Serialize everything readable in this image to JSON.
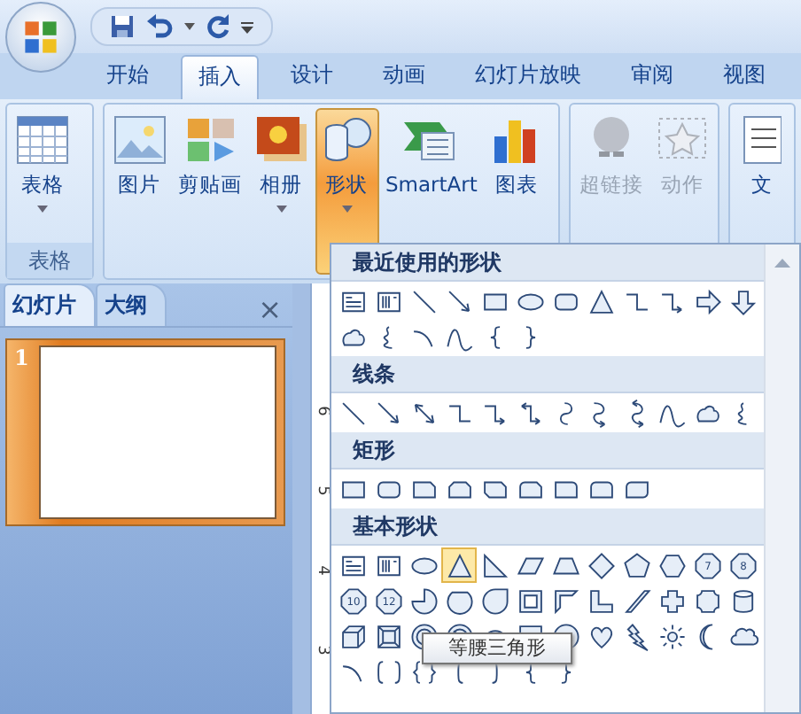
{
  "tabs": [
    {
      "label": "开始",
      "selected": false
    },
    {
      "label": "插入",
      "selected": true
    },
    {
      "label": "设计",
      "selected": false
    },
    {
      "label": "动画",
      "selected": false
    },
    {
      "label": "幻灯片放映",
      "selected": false
    },
    {
      "label": "审阅",
      "selected": false
    },
    {
      "label": "视图",
      "selected": false
    }
  ],
  "ribbon": {
    "groups": [
      {
        "label": "表格",
        "buttons": [
          {
            "kind": "table",
            "label": "表格",
            "has_menu": true,
            "disabled": false,
            "pressed": false
          }
        ]
      },
      {
        "buttons": [
          {
            "kind": "picture",
            "label": "图片",
            "has_menu": false,
            "disabled": false,
            "pressed": false
          },
          {
            "kind": "clipart",
            "label": "剪贴画",
            "has_menu": false,
            "disabled": false,
            "pressed": false
          },
          {
            "kind": "album",
            "label": "相册",
            "has_menu": true,
            "disabled": false,
            "pressed": false
          },
          {
            "kind": "shapes",
            "label": "形状",
            "has_menu": true,
            "disabled": false,
            "pressed": true
          },
          {
            "kind": "smartart",
            "label": "SmartArt",
            "has_menu": false,
            "disabled": false,
            "pressed": false
          },
          {
            "kind": "chart",
            "label": "图表",
            "has_menu": false,
            "disabled": false,
            "pressed": false
          }
        ]
      },
      {
        "buttons": [
          {
            "kind": "hyperlink",
            "label": "超链接",
            "has_menu": false,
            "disabled": true,
            "pressed": false
          },
          {
            "kind": "action",
            "label": "动作",
            "has_menu": false,
            "disabled": true,
            "pressed": false
          }
        ]
      },
      {
        "buttons": [
          {
            "kind": "textbox",
            "label": "文",
            "has_menu": false,
            "disabled": false,
            "pressed": false
          }
        ]
      }
    ]
  },
  "panel": {
    "tabs": [
      {
        "label": "幻灯片",
        "selected": true
      },
      {
        "label": "大纲",
        "selected": false
      }
    ],
    "close": "×",
    "slides": [
      {
        "number": "1",
        "selected": true
      }
    ]
  },
  "ruler": [
    "6",
    "5",
    "4",
    "3"
  ],
  "shapes_menu": {
    "sections": [
      {
        "title": "最近使用的形状",
        "shapes": [
          {
            "kind": "textbox",
            "selected": false
          },
          {
            "kind": "vtextbox",
            "selected": false
          },
          {
            "kind": "line",
            "selected": false
          },
          {
            "kind": "arrow",
            "selected": false
          },
          {
            "kind": "rect",
            "selected": false
          },
          {
            "kind": "oval",
            "selected": false
          },
          {
            "kind": "roundrect",
            "selected": false
          },
          {
            "kind": "triangle",
            "selected": false
          },
          {
            "kind": "elbow",
            "selected": false
          },
          {
            "kind": "elbow-arrow",
            "selected": false
          },
          {
            "kind": "right-arrow",
            "selected": false
          },
          {
            "kind": "down-arrow",
            "selected": false
          },
          {
            "kind": "freeform",
            "selected": false
          },
          {
            "kind": "scribble",
            "selected": false
          },
          {
            "kind": "arc",
            "selected": false
          },
          {
            "kind": "curve",
            "selected": false
          },
          {
            "kind": "left-brace",
            "selected": false
          },
          {
            "kind": "right-brace",
            "selected": false
          }
        ]
      },
      {
        "title": "线条",
        "shapes": [
          {
            "kind": "line",
            "selected": false
          },
          {
            "kind": "arrow",
            "selected": false
          },
          {
            "kind": "double-arrow",
            "selected": false
          },
          {
            "kind": "elbow",
            "selected": false
          },
          {
            "kind": "elbow-arrow",
            "selected": false
          },
          {
            "kind": "elbow-double",
            "selected": false
          },
          {
            "kind": "curve-connector",
            "selected": false
          },
          {
            "kind": "curve-arrow",
            "selected": false
          },
          {
            "kind": "curve-double",
            "selected": false
          },
          {
            "kind": "curve",
            "selected": false
          },
          {
            "kind": "freeform",
            "selected": false
          },
          {
            "kind": "scribble",
            "selected": false
          }
        ]
      },
      {
        "title": "矩形",
        "shapes": [
          {
            "kind": "rect",
            "selected": false
          },
          {
            "kind": "roundrect",
            "selected": false
          },
          {
            "kind": "snip-rect",
            "selected": false
          },
          {
            "kind": "snip-two",
            "selected": false
          },
          {
            "kind": "snip-diagonal",
            "selected": false
          },
          {
            "kind": "snip-round",
            "selected": false
          },
          {
            "kind": "round-one",
            "selected": false
          },
          {
            "kind": "round-two",
            "selected": false
          },
          {
            "kind": "round-diagonal",
            "selected": false
          }
        ]
      },
      {
        "title": "基本形状",
        "shapes": [
          {
            "kind": "textbox",
            "selected": false
          },
          {
            "kind": "vtextbox",
            "selected": false
          },
          {
            "kind": "oval",
            "selected": false
          },
          {
            "kind": "triangle",
            "selected": true
          },
          {
            "kind": "right-triangle",
            "selected": false
          },
          {
            "kind": "parallelogram",
            "selected": false
          },
          {
            "kind": "trapezoid",
            "selected": false
          },
          {
            "kind": "diamond",
            "selected": false
          },
          {
            "kind": "pentagon",
            "selected": false
          },
          {
            "kind": "hexagon",
            "selected": false
          },
          {
            "kind": "polygon",
            "label": "7",
            "selected": false
          },
          {
            "kind": "polygon",
            "label": "8",
            "selected": false
          },
          {
            "kind": "polygon",
            "label": "10",
            "selected": false
          },
          {
            "kind": "polygon",
            "label": "12",
            "selected": false
          },
          {
            "kind": "pie",
            "selected": false
          },
          {
            "kind": "chord",
            "selected": false
          },
          {
            "kind": "teardrop",
            "selected": false
          },
          {
            "kind": "frame",
            "selected": false
          },
          {
            "kind": "half-frame",
            "selected": false
          },
          {
            "kind": "l-shape",
            "selected": false
          },
          {
            "kind": "diagonal-stripe",
            "selected": false
          },
          {
            "kind": "cross",
            "selected": false
          },
          {
            "kind": "plaque",
            "selected": false
          },
          {
            "kind": "can",
            "selected": false
          },
          {
            "kind": "cube",
            "selected": false
          },
          {
            "kind": "bevel",
            "selected": false
          },
          {
            "kind": "donut",
            "selected": false
          },
          {
            "kind": "no-symbol",
            "selected": false
          },
          {
            "kind": "block-arc",
            "selected": false
          },
          {
            "kind": "folded-corner",
            "selected": false
          },
          {
            "kind": "smiley",
            "selected": false
          },
          {
            "kind": "heart",
            "selected": false
          },
          {
            "kind": "lightning",
            "selected": false
          },
          {
            "kind": "sun",
            "selected": false
          },
          {
            "kind": "moon",
            "selected": false
          },
          {
            "kind": "cloud",
            "selected": false
          },
          {
            "kind": "arc",
            "selected": false
          },
          {
            "kind": "bracket-pair",
            "selected": false
          },
          {
            "kind": "brace-pair",
            "selected": false
          },
          {
            "kind": "left-bracket",
            "selected": false
          },
          {
            "kind": "right-bracket",
            "selected": false
          },
          {
            "kind": "left-brace",
            "selected": false
          },
          {
            "kind": "right-brace",
            "selected": false
          }
        ]
      }
    ],
    "tooltip": "等腰三角形"
  }
}
